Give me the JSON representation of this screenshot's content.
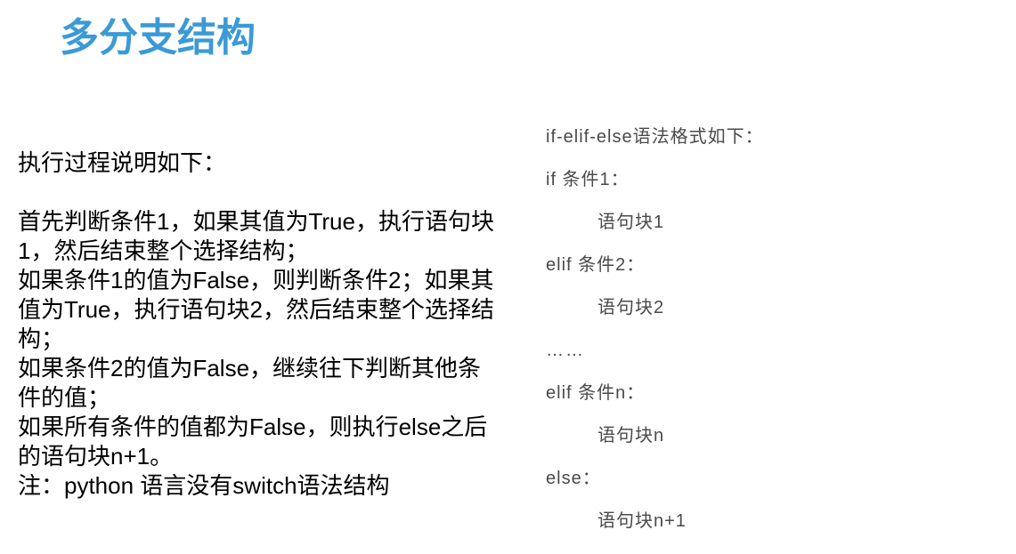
{
  "title": "多分支结构",
  "explanation": {
    "heading": "执行过程说明如下：",
    "paragraphs": [
      "首先判断条件1，如果其值为True，执行语句块1，然后结束整个选择结构；",
      "如果条件1的值为False，则判断条件2；如果其值为True，执行语句块2，然后结束整个选择结构；",
      "如果条件2的值为False，继续往下判断其他条件的值；",
      "如果所有条件的值都为False，则执行else之后的语句块n+1。",
      "注：python 语言没有switch语法结构"
    ]
  },
  "syntax": {
    "heading": "if-elif-else语法格式如下：",
    "lines": [
      "if 条件1：",
      "语句块1",
      "elif 条件2：",
      "语句块2",
      "……",
      "elif 条件n：",
      "语句块n",
      "else：",
      "语句块n+1"
    ]
  }
}
